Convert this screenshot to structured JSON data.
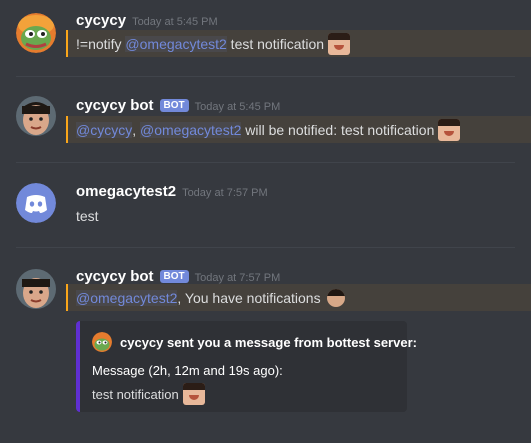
{
  "messages": [
    {
      "username": "cycycy",
      "timestamp": "Today at 5:45 PM",
      "text_prefix": "!=notify ",
      "mention": "@omegacytest2",
      "text_suffix": " test notification",
      "avatar_icon": "pepe-frog-icon"
    },
    {
      "username": "cycycy bot",
      "bot_tag": "BOT",
      "timestamp": "Today at 5:45 PM",
      "mention_1": "@cycycy",
      "separator": ", ",
      "mention_2": "@omegacytest2",
      "text_suffix": " will be notified: test notification",
      "avatar_icon": "face-photo-icon"
    },
    {
      "username": "omegacytest2",
      "timestamp": "Today at 7:57 PM",
      "text": "test",
      "avatar_icon": "discord-logo-icon"
    },
    {
      "username": "cycycy bot",
      "bot_tag": "BOT",
      "timestamp": "Today at 7:57 PM",
      "mention": "@omegacytest2",
      "text_suffix": ", You have notifications",
      "avatar_icon": "face-photo-icon"
    }
  ],
  "embed": {
    "author": "cycycy sent you a message from bottest server:",
    "field_name": "Message (2h, 12m and 19s ago):",
    "field_value": "test notification",
    "accent_color": "#5f2fd2"
  },
  "colors": {
    "background": "#36393f",
    "mention": "#7289da",
    "highlight_bar": "#faa61a",
    "bot_tag": "#7289da"
  }
}
